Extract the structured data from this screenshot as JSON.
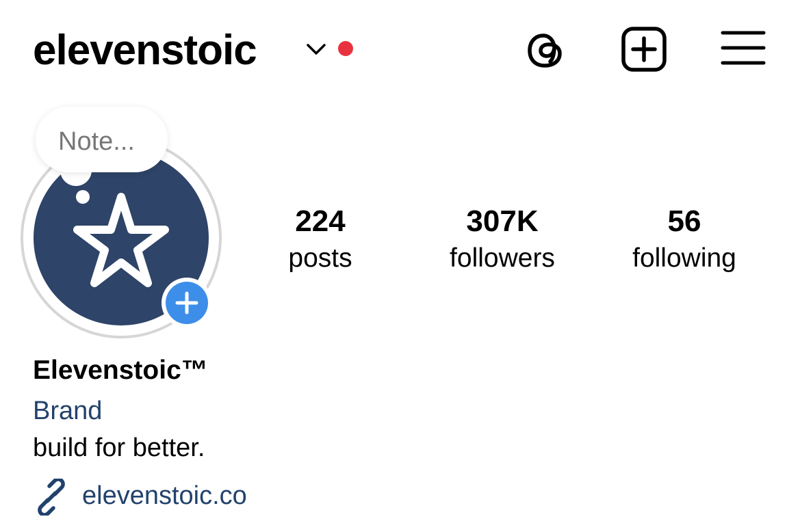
{
  "header": {
    "username": "elevenstoic",
    "icons": {
      "switch_account": "chevron-down-icon",
      "notification": "red-dot-indicator",
      "threads": "threads-icon",
      "new_post": "plus-square-icon",
      "menu": "hamburger-menu-icon"
    },
    "notification_color": "#e8333f"
  },
  "note": {
    "placeholder": "Note..."
  },
  "avatar": {
    "icon": "star-icon",
    "background": "#2e4468",
    "add_story_icon": "plus-circle-icon",
    "add_story_color": "#3d8ee9"
  },
  "stats": [
    {
      "value": "224",
      "label": "posts"
    },
    {
      "value": "307K",
      "label": "followers"
    },
    {
      "value": "56",
      "label": "following"
    }
  ],
  "bio": {
    "display_name": "Elevenstoic™",
    "category": "Brand",
    "text": "build for better.",
    "link_icon": "link-icon",
    "link": "elevenstoic.co",
    "link_color": "#22426c"
  }
}
